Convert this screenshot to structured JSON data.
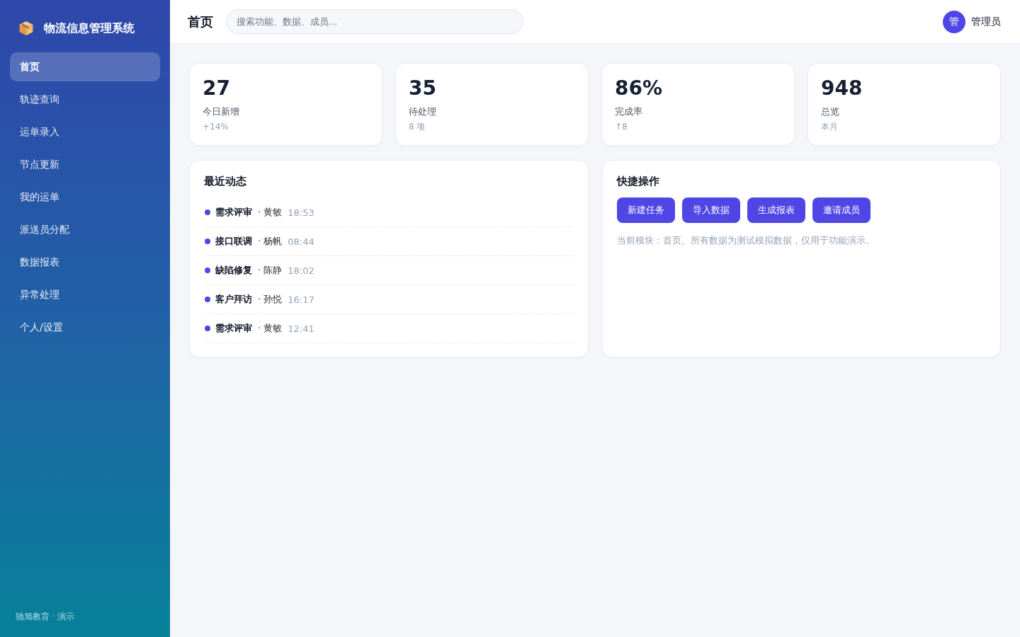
{
  "sidebar": {
    "brand": "物流信息管理系统",
    "items": [
      {
        "label": "首页",
        "selected": true
      },
      {
        "label": "轨迹查询",
        "selected": false
      },
      {
        "label": "运单录入",
        "selected": false
      },
      {
        "label": "节点更新",
        "selected": false
      },
      {
        "label": "我的运单",
        "selected": false
      },
      {
        "label": "派送员分配",
        "selected": false
      },
      {
        "label": "数据报表",
        "selected": false
      },
      {
        "label": "异常处理",
        "selected": false
      },
      {
        "label": "个人/设置",
        "selected": false
      }
    ],
    "footer": "驰旭教育 · 演示"
  },
  "header": {
    "title": "首页",
    "search": {
      "placeholder": "搜索功能、数据、成员..."
    },
    "user": {
      "avatar": "管",
      "name": "管理员"
    }
  },
  "stats": [
    {
      "value": "27",
      "label": "今日新增",
      "note": "+14%"
    },
    {
      "value": "35",
      "label": "待处理",
      "note": "8 项"
    },
    {
      "value": "86%",
      "label": "完成率",
      "note": "↑8"
    },
    {
      "value": "948",
      "label": "总览",
      "note": "本月"
    }
  ],
  "recent": {
    "title": "最近动态",
    "items": [
      {
        "title": "需求评审",
        "person": "· 黄敏",
        "time": "18:53"
      },
      {
        "title": "接口联调",
        "person": "· 杨帆",
        "time": "08:44"
      },
      {
        "title": "缺陷修复",
        "person": "· 陈静",
        "time": "18:02"
      },
      {
        "title": "客户拜访",
        "person": "· 孙悦",
        "time": "16:17"
      },
      {
        "title": "需求评审",
        "person": "· 黄敏",
        "time": "12:41"
      }
    ]
  },
  "quick": {
    "title": "快捷操作",
    "buttons": [
      "新建任务",
      "导入数据",
      "生成报表",
      "邀请成员"
    ],
    "note": "当前模块：首页。所有数据为测试模拟数据，仅用于功能演示。"
  }
}
